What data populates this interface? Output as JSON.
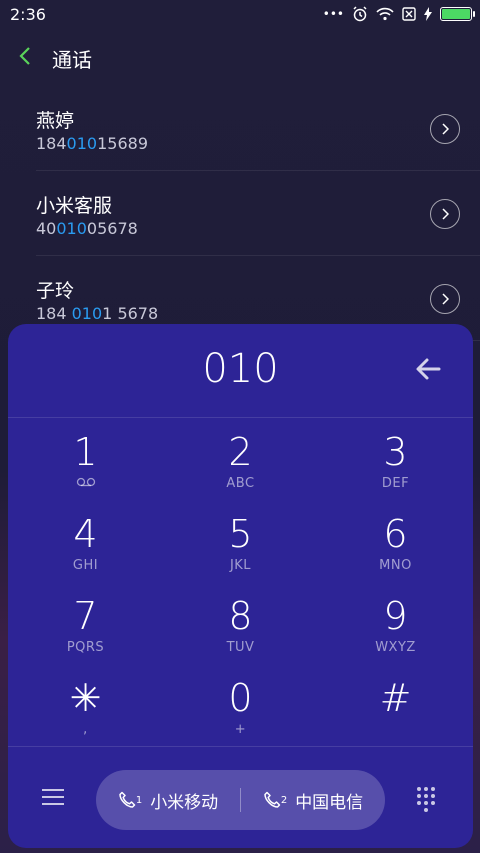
{
  "status_bar": {
    "time": "2:36",
    "dots": "•••"
  },
  "header": {
    "title": "通话"
  },
  "contacts": [
    {
      "name": "燕婷",
      "num_pre": "184",
      "num_hl": "010",
      "num_post": "15689"
    },
    {
      "name": "小米客服",
      "num_pre": "40",
      "num_hl": "010",
      "num_post": "05678"
    },
    {
      "name": "子玲",
      "num_pre": "184 ",
      "num_hl": "010",
      "num_post": "1 5678"
    }
  ],
  "dialpad": {
    "input": "010",
    "keys": [
      {
        "num": "1",
        "sub": "voicemail"
      },
      {
        "num": "2",
        "sub": "ABC"
      },
      {
        "num": "3",
        "sub": "DEF"
      },
      {
        "num": "4",
        "sub": "GHI"
      },
      {
        "num": "5",
        "sub": "JKL"
      },
      {
        "num": "6",
        "sub": "MNO"
      },
      {
        "num": "7",
        "sub": "PQRS"
      },
      {
        "num": "8",
        "sub": "TUV"
      },
      {
        "num": "9",
        "sub": "WXYZ"
      },
      {
        "num": "✳",
        "sub": ","
      },
      {
        "num": "0",
        "sub": "+"
      },
      {
        "num": "#",
        "sub": ""
      }
    ],
    "sim1": {
      "index": "1",
      "label": "小米移动"
    },
    "sim2": {
      "index": "2",
      "label": "中国电信"
    }
  },
  "colors": {
    "accent_green": "#5ad35a",
    "highlight_blue": "#2a9bf0",
    "panel": "#2d2496"
  }
}
